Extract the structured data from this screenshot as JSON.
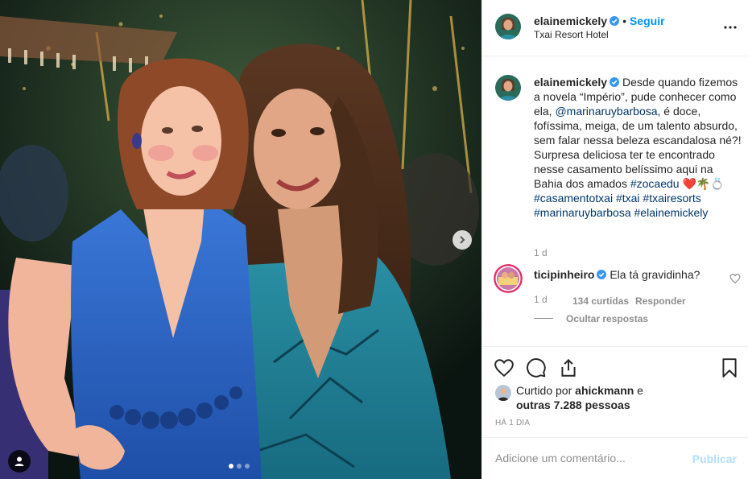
{
  "post": {
    "username": "elainemickely",
    "follow_label": "Seguir",
    "separator": "•",
    "location": "Txai Resort Hotel",
    "carousel": {
      "current_slide": 1,
      "total_slides": 3
    }
  },
  "caption": {
    "username": "elainemickely",
    "text_1": "Desde quando fizemos a novela “Império”, pude conhecer como ela, ",
    "mention": "@marinaruybarbosa",
    "text_2": ", é doce, fofíssima, meiga, de um talento absurdo, sem falar nessa beleza escandalosa né?! Surpresa deliciosa ter te encontrado nesse casamento belíssimo aqui na Bahia dos amados ",
    "hashtag_1": "#zocaedu",
    "emojis": "❤️🌴💍",
    "hashtag_2": "#casamentotxai",
    "hashtag_3": "#txai",
    "hashtag_4": "#txairesorts",
    "hashtag_5": "#marinaruybarbosa",
    "hashtag_6": "#elainemickely",
    "time": "1 d"
  },
  "reply": {
    "username": "ticipinheiro",
    "text": "Ela tá gravidinha?",
    "time": "1 d",
    "likes": "134 curtidas",
    "reply_label": "Responder",
    "hide_replies": "Ocultar respostas"
  },
  "likes": {
    "prefix": "Curtido por ",
    "user": "ahickmann",
    "middle": " e",
    "others": "outras 7.288 pessoas"
  },
  "date": "HÁ 1 DIA",
  "add_comment": {
    "placeholder": "Adicione um comentário...",
    "post_label": "Publicar"
  },
  "colors": {
    "accent": "#0095f6",
    "link": "#00376b",
    "muted": "#8e8e8e",
    "post_disabled": "#b2dffc",
    "heart_red": "#ed4956"
  }
}
